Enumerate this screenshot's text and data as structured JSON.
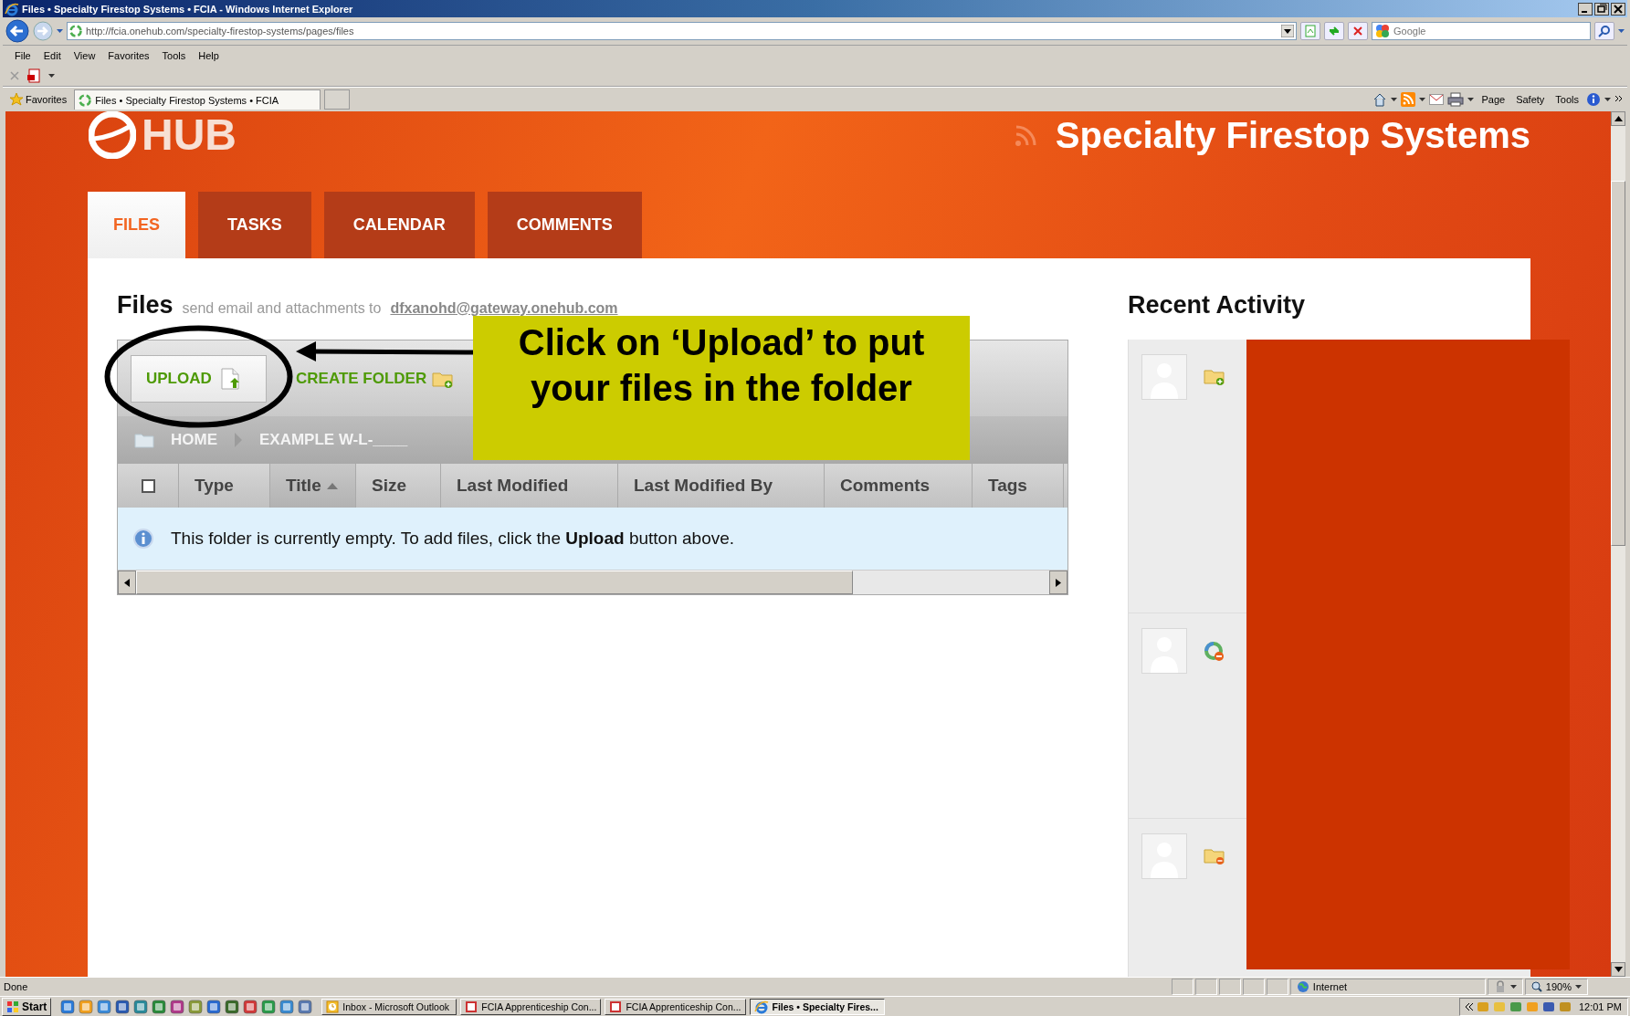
{
  "window": {
    "title": "Files • Specialty Firestop Systems • FCIA - Windows Internet Explorer"
  },
  "address_bar": {
    "url": "http://fcia.onehub.com/specialty-firestop-systems/pages/files",
    "search_placeholder": "Google"
  },
  "menu": [
    "File",
    "Edit",
    "View",
    "Favorites",
    "Tools",
    "Help"
  ],
  "favorites_bar": {
    "label": "Favorites",
    "tabs": [
      {
        "title": "Files • Specialty Firestop Systems • FCIA",
        "selected": true
      }
    ]
  },
  "command_bar": [
    "Page",
    "Safety",
    "Tools"
  ],
  "page": {
    "logo": "HUB",
    "workspace": "Specialty Firestop Systems",
    "tabs": [
      {
        "label": "FILES",
        "selected": true
      },
      {
        "label": "TASKS",
        "selected": false
      },
      {
        "label": "CALENDAR",
        "selected": false
      },
      {
        "label": "COMMENTS",
        "selected": false
      }
    ],
    "files": {
      "heading": "Files",
      "hint": "send email and attachments to",
      "email": "dfxanohd@gateway.onehub.com",
      "actions": [
        {
          "kind": "upload",
          "label": "UPLOAD"
        },
        {
          "kind": "folder",
          "label": "CREATE FOLDER"
        }
      ],
      "breadcrumb": [
        "HOME",
        "EXAMPLE W-L-____"
      ],
      "select_all": {
        "checked": false
      },
      "columns": [
        {
          "label": "Type",
          "sorted": false
        },
        {
          "label": "Title",
          "sorted": true
        },
        {
          "label": "Size",
          "sorted": false
        },
        {
          "label": "Last Modified",
          "sorted": false
        },
        {
          "label": "Last Modified By",
          "sorted": false
        },
        {
          "label": "Comments",
          "sorted": false
        },
        {
          "label": "Tags",
          "sorted": false
        }
      ],
      "empty_message": "This folder is currently empty. To add files, click the **Upload** button above."
    },
    "recent_activity": {
      "heading": "Recent Activity",
      "items": [
        {
          "kind": "folder_added"
        },
        {
          "kind": "share_removed"
        },
        {
          "kind": "folder_removed"
        }
      ]
    },
    "callout": {
      "text": "Click on ‘Upload’ to put your files in the folder"
    }
  },
  "status_bar": {
    "text": "Done",
    "zone": "Internet",
    "zoom": "190%"
  },
  "taskbar": {
    "start": "Start",
    "tasks": [
      {
        "kind": "mail",
        "title": "Inbox - Microsoft Outlook",
        "selected": false
      },
      {
        "kind": "document",
        "title": "FCIA Apprenticeship Con...",
        "selected": false
      },
      {
        "kind": "document",
        "title": "FCIA Apprenticeship Con...",
        "selected": false
      },
      {
        "kind": "browser",
        "title": "Files • Specialty Fires...",
        "selected": true
      }
    ],
    "clock": "12:01 PM"
  }
}
